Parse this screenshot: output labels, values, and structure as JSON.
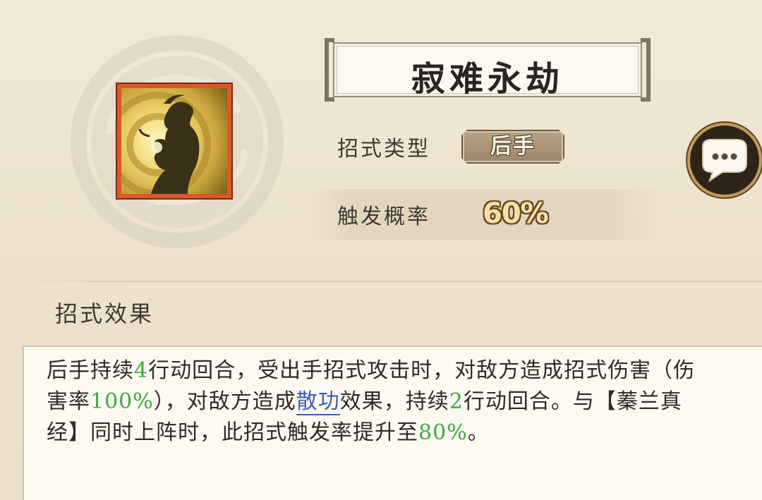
{
  "skill": {
    "name": "寂难永劫",
    "icon": "meditating-figure-icon"
  },
  "attributes": {
    "type_label": "招式类型",
    "type_value": "后手",
    "trigger_label": "触发概率",
    "trigger_value": "60%"
  },
  "effect": {
    "section_label": "招式效果",
    "segments": [
      {
        "t": "后手持续"
      },
      {
        "t": "4",
        "c": "num"
      },
      {
        "t": "行动回合，受出手招式攻击时，对敌方造成招式伤害（伤害率"
      },
      {
        "t": "100%",
        "c": "num"
      },
      {
        "t": "），对敌方造成"
      },
      {
        "t": "散功",
        "c": "kw"
      },
      {
        "t": "效果，持续"
      },
      {
        "t": "2",
        "c": "num"
      },
      {
        "t": "行动回合。与【蓁兰真经】同时上阵时，此招式触发率提升至"
      },
      {
        "t": "80%",
        "c": "num"
      },
      {
        "t": "。"
      }
    ]
  },
  "chat": {
    "icon": "chat-bubble-icon"
  },
  "colors": {
    "highlight_number": "#3da93d",
    "keyword_link": "#3e5bb3",
    "icon_frame": "#d9592a"
  }
}
